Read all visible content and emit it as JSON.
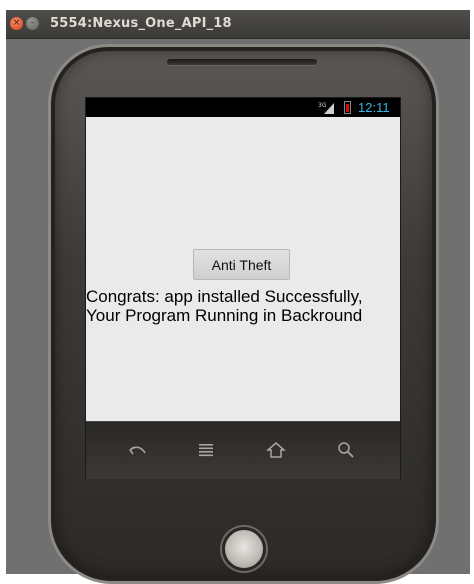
{
  "window": {
    "title": "5554:Nexus_One_API_18",
    "close_glyph": "×",
    "minimize_glyph": "–"
  },
  "status_bar": {
    "network_type": "3G",
    "time": "12:11",
    "signal_icon": "signal-icon",
    "battery_icon": "battery-icon",
    "battery_color": "#d01010",
    "clock_color": "#33b5e5"
  },
  "app": {
    "button_label": "Anti Theft",
    "message": "Congrats: app installed Successfully, Your Program Running in Backround"
  },
  "navigation": {
    "keys": [
      "back-icon",
      "menu-icon",
      "home-icon",
      "search-icon"
    ]
  }
}
